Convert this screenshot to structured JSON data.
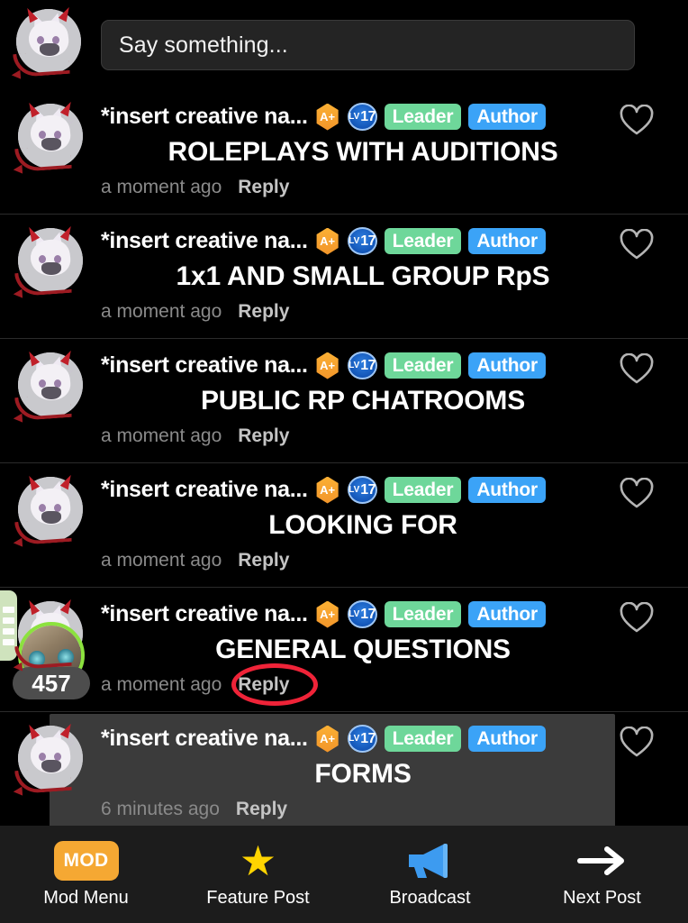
{
  "composer": {
    "placeholder": "Say something...",
    "avatar_name": "user-avatar"
  },
  "badges": {
    "gem_label": "A+",
    "level_prefix": "LV",
    "level_number": "17",
    "leader_label": "Leader",
    "author_label": "Author"
  },
  "common": {
    "reply_label": "Reply",
    "username": "*insert creative na..."
  },
  "comments": [
    {
      "username": "*insert creative na...",
      "text": "ROLEPLAYS WITH AUDITIONS",
      "timestamp": "a moment ago",
      "reply": "Reply"
    },
    {
      "username": "*insert creative na...",
      "text": "1x1 AND SMALL GROUP RpS",
      "timestamp": "a moment ago",
      "reply": "Reply"
    },
    {
      "username": "*insert creative na...",
      "text": "PUBLIC RP CHATROOMS",
      "timestamp": "a moment ago",
      "reply": "Reply"
    },
    {
      "username": "*insert creative na...",
      "text": "LOOKING FOR",
      "timestamp": "a moment ago",
      "reply": "Reply"
    },
    {
      "username": "*insert creative na...",
      "text": "GENERAL QUESTIONS",
      "timestamp": "a moment ago",
      "reply": "Reply"
    },
    {
      "username": "*insert creative na...",
      "text": "FORMS",
      "timestamp": "6 minutes ago",
      "reply": "Reply"
    }
  ],
  "overlay": {
    "floating_count": "457",
    "side_tab_name": "menu-handle"
  },
  "bottom_bar": {
    "items": [
      {
        "icon": "mod-badge-icon",
        "chip_text": "MOD",
        "label": "Mod Menu"
      },
      {
        "icon": "star-icon",
        "chip_text": "",
        "label": "Feature Post"
      },
      {
        "icon": "megaphone-icon",
        "chip_text": "",
        "label": "Broadcast"
      },
      {
        "icon": "arrow-right-icon",
        "chip_text": "",
        "label": "Next Post"
      }
    ]
  },
  "colors": {
    "background": "#000000",
    "input_bg": "#242424",
    "leader_tag": "#6ed79a",
    "author_tag": "#3ba3f7",
    "gem_gold": "#f5a833",
    "level_blue": "#1356b8",
    "annotation_red": "#ef2338",
    "story_ring_green": "#8ce23e",
    "bottom_bar_bg": "#1c1c1c"
  }
}
